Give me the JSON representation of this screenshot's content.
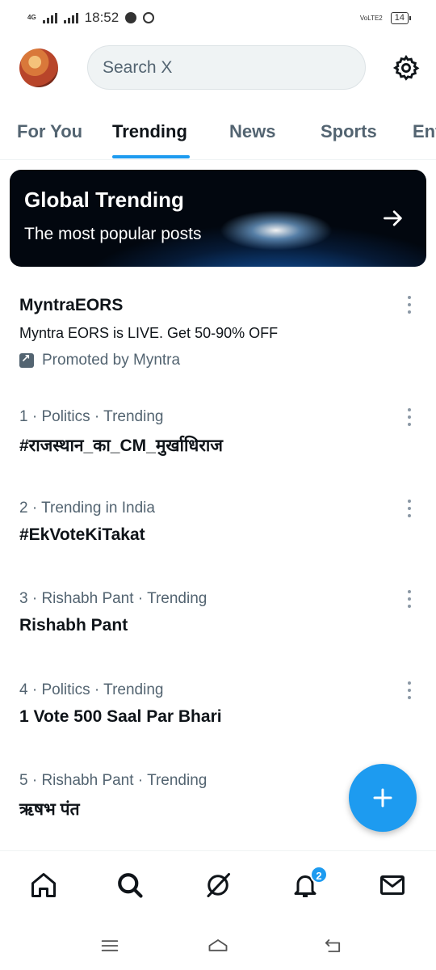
{
  "status_bar": {
    "network": "4G",
    "time": "18:52",
    "carrier_label": "VoLTE2",
    "battery": "14"
  },
  "header": {
    "search_placeholder": "Search X"
  },
  "tabs": [
    {
      "label": "For You",
      "active": false
    },
    {
      "label": "Trending",
      "active": true
    },
    {
      "label": "News",
      "active": false
    },
    {
      "label": "Sports",
      "active": false
    },
    {
      "label": "Ent",
      "active": false
    }
  ],
  "banner": {
    "title": "Global Trending",
    "subtitle": "The most popular posts"
  },
  "promoted": {
    "title": "MyntraEORS",
    "description": "Myntra EORS is LIVE. Get 50-90% OFF",
    "promoted_by": "Promoted by Myntra"
  },
  "trends": [
    {
      "meta": "1 · Politics · Trending",
      "headline": "#राजस्थान_का_CM_मुर्खाधिराज"
    },
    {
      "meta": "2 · Trending in India",
      "headline": "#EkVoteKiTakat"
    },
    {
      "meta": "3 · Rishabh Pant · Trending",
      "headline": "Rishabh Pant"
    },
    {
      "meta": "4 · Politics · Trending",
      "headline": "1 Vote 500 Saal Par Bhari"
    },
    {
      "meta": "5 · Rishabh Pant · Trending",
      "headline": "ऋषभ पंत"
    }
  ],
  "bottom_nav": {
    "notifications_badge": "2"
  },
  "colors": {
    "accent": "#1d9bf0",
    "text_primary": "#0f1419",
    "text_secondary": "#536471"
  }
}
